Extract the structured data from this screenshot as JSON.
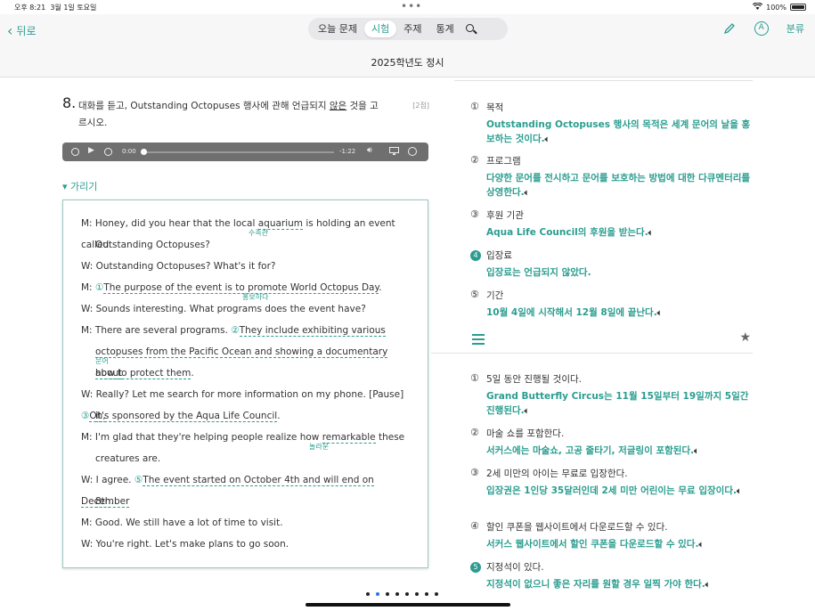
{
  "status": {
    "time": "오후 8:21",
    "date": "3월 1일 토요일",
    "battery": "100%"
  },
  "nav": {
    "back": "뒤로",
    "tabs": [
      {
        "label": "오늘 문제"
      },
      {
        "label": "시험"
      },
      {
        "label": "주제"
      },
      {
        "label": "통계"
      }
    ],
    "active_tab": "시험",
    "classify": "분류",
    "exam_title": "2025학년도 정시"
  },
  "question": {
    "number": "8.",
    "text_before": "대화를 듣고, Outstanding Octopuses 행사에 관해 언급되지 ",
    "text_underline": "않은",
    "text_after": " 것을 고르시오.",
    "points": "[2점]",
    "player": {
      "current": "0:00",
      "remaining": "-1:22"
    },
    "hide_label": "가리기"
  },
  "script": [
    {
      "a": "M: Honey, did you hear that the local ",
      "hl": "aquarium",
      "b": " is holding an event called"
    },
    {
      "a": "Outstanding Octopuses?"
    },
    {
      "a": "W: Outstanding Octopuses? What's it for?"
    },
    {
      "a": "M: ",
      "mark": "①",
      "hl": "The purpose of the event is to promote World Octopus Day",
      "b": "."
    },
    {
      "a": "W: Sounds interesting. What programs does the event have?"
    },
    {
      "a": "M: There are several programs. ",
      "mark": "②",
      "hl": "They include exhibiting various"
    },
    {
      "hl": "octopuses from the Pacific Ocean and showing a documentary about"
    },
    {
      "hl": "how to protect them",
      "b": "."
    },
    {
      "a": "W: Really? Let me search for more information on my phone. [Pause] ",
      "mark": "③",
      "hl": "Oh,"
    },
    {
      "hl": "it's sponsored by the Aqua Life Council",
      "b": "."
    },
    {
      "a": "M: I'm glad that they're helping people realize how ",
      "hl": "remarkable",
      "b": " these"
    },
    {
      "a": "creatures are."
    },
    {
      "a": "W: I agree. ",
      "mark": "⑤",
      "hl": "The event started on October 4th and will end on December"
    },
    {
      "hl": "8th",
      "b": "."
    },
    {
      "a": "M: Good. We still have a lot of time to visit."
    },
    {
      "a": "W: You're right. Let's make plans to go soon."
    }
  ],
  "glosses": [
    "수족관",
    "홍보하다",
    "문어",
    "놀라운"
  ],
  "options_q8": [
    {
      "num": "①",
      "label": "목적",
      "expl": "Outstanding Octopuses 행사의 목적은 세계 문어의 날을 홍보하는 것이다."
    },
    {
      "num": "②",
      "label": "프로그램",
      "expl": "다양한 문어를 전시하고 문어를 보호하는 방법에 대한 다큐멘터리를 상영한다."
    },
    {
      "num": "③",
      "label": "후원 기관",
      "expl": "Aqua Life Council의 후원을 받는다."
    },
    {
      "num": "4",
      "label": "입장료",
      "expl": "입장료는 언급되지 않았다.",
      "answer": true
    },
    {
      "num": "⑤",
      "label": "기간",
      "expl": "10월 4일에 시작해서 12월 8일에 끝난다."
    }
  ],
  "options_q9": [
    {
      "num": "①",
      "label": "5일 동안 진행될 것이다.",
      "expl": "Grand Butterfly Circus는 11월 15일부터 19일까지 5일간 진행된다."
    },
    {
      "num": "②",
      "label": "마술 쇼를 포함한다.",
      "expl": "서커스에는 마술쇼, 고공 줄타기, 저글링이 포함된다."
    },
    {
      "num": "③",
      "label": "2세 미만의 아이는 무료로 입장한다.",
      "expl": "입장권은 1인당 35달러인데 2세 미만 어린이는 무료 입장이다."
    },
    {
      "num": "④",
      "label": "할인 쿠폰을 웹사이트에서 다운로드할 수 있다.",
      "expl": "서커스 웹사이트에서 할인 쿠폰을 다운로드할 수 있다."
    },
    {
      "num": "5",
      "label": "지정석이 있다.",
      "expl": "지정석이 없으니 좋은 자리를 원할 경우 일찍 가야 한다.",
      "answer": true
    }
  ],
  "icons": [
    "back-chevron-icon",
    "search-icon",
    "pencil-icon",
    "a-circle-icon",
    "speaker-icon",
    "list-icon",
    "star-icon"
  ],
  "accent_color": "#2a9d8f"
}
